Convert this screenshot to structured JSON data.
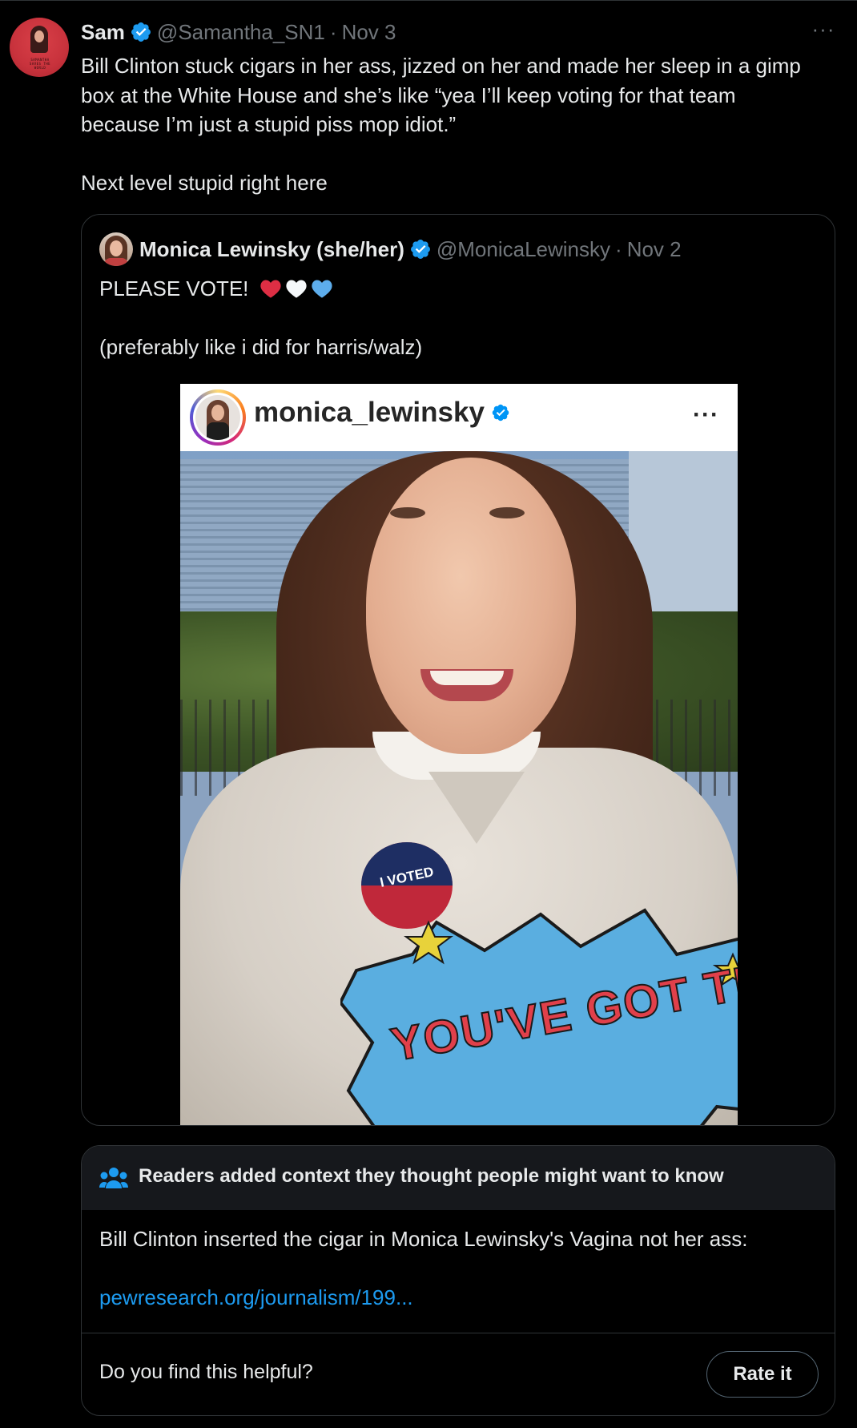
{
  "tweet": {
    "author_name": "Sam",
    "handle": "@Samantha_SN1",
    "separator": "·",
    "date": "Nov 3",
    "more_label": "···",
    "text_line1": "Bill Clinton stuck cigars in her ass, jizzed on her and made her sleep in a gimp box at the White House and she’s like “yea I’ll keep voting for that team because I’m just a stupid piss mop idiot.”",
    "text_line2": "Next level stupid right here",
    "avatar_text": "SAMANTHA SAVES THE WORLD"
  },
  "quote": {
    "author_name": "Monica Lewinsky (she/her)",
    "handle": "@MonicaLewinsky",
    "separator": "·",
    "date": "Nov 2",
    "text_line1": "PLEASE VOTE!",
    "hearts": [
      "red-heart-icon",
      "white-heart-icon",
      "blue-heart-icon"
    ],
    "text_line2": "(preferably like i did for harris/walz)",
    "embedded_post": {
      "username": "monica_lewinsky",
      "more_label": "···",
      "sticker_text": "I VOTED",
      "sweater_text": "YOU'VE GOT THE POWER!"
    }
  },
  "community_note": {
    "title": "Readers added context they thought people might want to know",
    "body": "Bill Clinton inserted the cigar in Monica Lewinsky's Vagina not her ass:",
    "link": "pewresearch.org/journalism/199...",
    "question": "Do you find this helpful?",
    "rate_label": "Rate it"
  },
  "colors": {
    "background": "#000000",
    "text": "#e7e9ea",
    "muted": "#71767b",
    "accent": "#1d9bf0",
    "border": "#2f3336"
  }
}
